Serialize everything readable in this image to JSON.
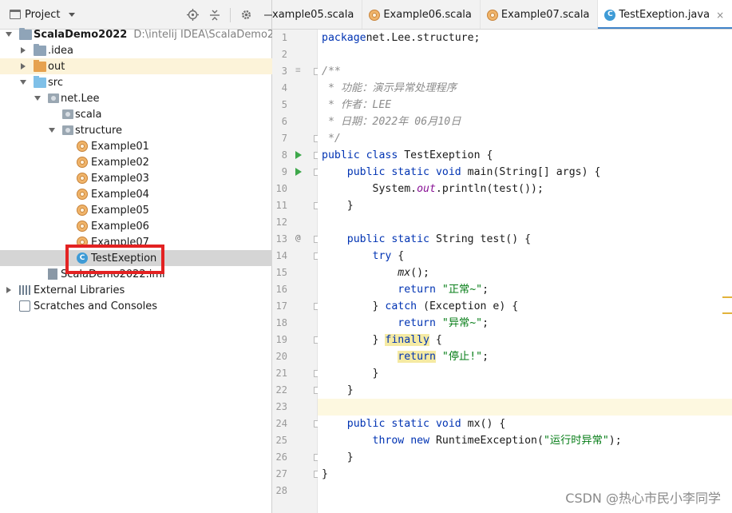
{
  "project_panel": {
    "title": "Project",
    "tree": [
      {
        "label": "ScalaDemo2022",
        "extra": "D:\\intelij IDEA\\ScalaDemo2022",
        "icon": "module-folder-icon",
        "indent": 0,
        "arrow": "down",
        "bold": true
      },
      {
        "label": ".idea",
        "icon": "folder-icon",
        "indent": 1,
        "arrow": "right"
      },
      {
        "label": "out",
        "icon": "excluded-folder-icon",
        "indent": 1,
        "arrow": "right",
        "highlight": "out"
      },
      {
        "label": "src",
        "icon": "source-folder-icon",
        "indent": 1,
        "arrow": "down"
      },
      {
        "label": "net.Lee",
        "icon": "package-icon",
        "indent": 2,
        "arrow": "down"
      },
      {
        "label": "scala",
        "icon": "package-icon",
        "indent": 3,
        "arrow": "none"
      },
      {
        "label": "structure",
        "icon": "package-icon",
        "indent": 3,
        "arrow": "down"
      },
      {
        "label": "Example01",
        "icon": "scala-object-icon",
        "indent": 4,
        "arrow": "none"
      },
      {
        "label": "Example02",
        "icon": "scala-object-icon",
        "indent": 4,
        "arrow": "none"
      },
      {
        "label": "Example03",
        "icon": "scala-object-icon",
        "indent": 4,
        "arrow": "none"
      },
      {
        "label": "Example04",
        "icon": "scala-object-icon",
        "indent": 4,
        "arrow": "none"
      },
      {
        "label": "Example05",
        "icon": "scala-object-icon",
        "indent": 4,
        "arrow": "none"
      },
      {
        "label": "Example06",
        "icon": "scala-object-icon",
        "indent": 4,
        "arrow": "none"
      },
      {
        "label": "Example07",
        "icon": "scala-object-icon",
        "indent": 4,
        "arrow": "none"
      },
      {
        "label": "TestExeption",
        "icon": "java-class-icon",
        "indent": 4,
        "arrow": "none",
        "selected": true
      },
      {
        "label": "ScalaDemo2022.iml",
        "icon": "iml-file-icon",
        "indent": 2,
        "arrow": "none"
      },
      {
        "label": "External Libraries",
        "icon": "libraries-icon",
        "indent": 0,
        "arrow": "right"
      },
      {
        "label": "Scratches and Consoles",
        "icon": "scratches-icon",
        "indent": 0,
        "arrow": "none"
      }
    ]
  },
  "editor": {
    "tabs": [
      {
        "label": "xample05.scala",
        "icon": "scala-object-icon",
        "active": false,
        "has_icon": false
      },
      {
        "label": "Example06.scala",
        "icon": "scala-object-icon",
        "active": false
      },
      {
        "label": "Example07.scala",
        "icon": "scala-object-icon",
        "active": false
      },
      {
        "label": "TestExeption.java",
        "icon": "java-class-icon",
        "active": true,
        "close": "×"
      }
    ],
    "current_line": 23,
    "lines": [
      {
        "n": "1",
        "tokens": [
          [
            "kw",
            "package"
          ],
          [
            "",
            "net.Lee.structure;"
          ]
        ]
      },
      {
        "n": "2",
        "tokens": []
      },
      {
        "n": "3",
        "tokens": [
          [
            "doc",
            "/**"
          ]
        ],
        "gutter": "doc"
      },
      {
        "n": "4",
        "tokens": [
          [
            "doc",
            " * 功能：演示异常处理程序"
          ]
        ]
      },
      {
        "n": "5",
        "tokens": [
          [
            "doc",
            " * 作者：LEE"
          ]
        ]
      },
      {
        "n": "6",
        "tokens": [
          [
            "doc",
            " * 日期：2022年 06月10日"
          ]
        ]
      },
      {
        "n": "7",
        "tokens": [
          [
            "doc",
            " */"
          ]
        ]
      },
      {
        "n": "8",
        "tokens": [
          [
            "kw",
            "public"
          ],
          [
            "",
            " "
          ],
          [
            "kw",
            "class"
          ],
          [
            "",
            " TestExeption {"
          ]
        ],
        "gutter": "run"
      },
      {
        "n": "9",
        "tokens": [
          [
            "",
            "    "
          ],
          [
            "kw",
            "public"
          ],
          [
            "",
            " "
          ],
          [
            "kw",
            "static"
          ],
          [
            "",
            " "
          ],
          [
            "kw",
            "void"
          ],
          [
            "",
            " main(String[] args) {"
          ]
        ],
        "gutter": "run"
      },
      {
        "n": "10",
        "tokens": [
          [
            "",
            "        System."
          ],
          [
            "fn-italic",
            "out"
          ],
          [
            "",
            ".println(test());"
          ]
        ]
      },
      {
        "n": "11",
        "tokens": [
          [
            "",
            "    }"
          ]
        ]
      },
      {
        "n": "12",
        "tokens": []
      },
      {
        "n": "13",
        "tokens": [
          [
            "",
            "    "
          ],
          [
            "kw",
            "public"
          ],
          [
            "",
            " "
          ],
          [
            "kw",
            "static"
          ],
          [
            "",
            " String test() {"
          ]
        ],
        "gutter": "at"
      },
      {
        "n": "14",
        "tokens": [
          [
            "",
            "        "
          ],
          [
            "kw",
            "try"
          ],
          [
            "",
            " {"
          ]
        ]
      },
      {
        "n": "15",
        "tokens": [
          [
            "",
            "            "
          ],
          [
            "italic",
            "mx"
          ],
          [
            "",
            "();"
          ]
        ]
      },
      {
        "n": "16",
        "tokens": [
          [
            "",
            "            "
          ],
          [
            "kw",
            "return"
          ],
          [
            "",
            " "
          ],
          [
            "str",
            "\"正常~\""
          ],
          [
            "",
            ";"
          ]
        ]
      },
      {
        "n": "17",
        "tokens": [
          [
            "",
            "        } "
          ],
          [
            "kw",
            "catch"
          ],
          [
            "",
            " (Exception e) {"
          ]
        ]
      },
      {
        "n": "18",
        "tokens": [
          [
            "",
            "            "
          ],
          [
            "kw",
            "return"
          ],
          [
            "",
            " "
          ],
          [
            "str",
            "\"异常~\""
          ],
          [
            "",
            ";"
          ]
        ]
      },
      {
        "n": "19",
        "tokens": [
          [
            "",
            "        } "
          ],
          [
            "kw hl",
            "finally"
          ],
          [
            "",
            " {"
          ]
        ]
      },
      {
        "n": "20",
        "tokens": [
          [
            "",
            "            "
          ],
          [
            "kw hl",
            "return"
          ],
          [
            "",
            " "
          ],
          [
            "str",
            "\"停止!\""
          ],
          [
            "",
            ";"
          ]
        ]
      },
      {
        "n": "21",
        "tokens": [
          [
            "",
            "        }"
          ]
        ]
      },
      {
        "n": "22",
        "tokens": [
          [
            "",
            "    }"
          ]
        ]
      },
      {
        "n": "23",
        "tokens": []
      },
      {
        "n": "24",
        "tokens": [
          [
            "",
            "    "
          ],
          [
            "kw",
            "public"
          ],
          [
            "",
            " "
          ],
          [
            "kw",
            "static"
          ],
          [
            "",
            " "
          ],
          [
            "kw",
            "void"
          ],
          [
            "",
            " mx() {"
          ]
        ]
      },
      {
        "n": "25",
        "tokens": [
          [
            "",
            "        "
          ],
          [
            "kw",
            "throw"
          ],
          [
            "",
            " "
          ],
          [
            "kw",
            "new"
          ],
          [
            "",
            " RuntimeException("
          ],
          [
            "str",
            "\"运行时异常\""
          ],
          [
            "",
            ");"
          ]
        ]
      },
      {
        "n": "26",
        "tokens": [
          [
            "",
            "    }"
          ]
        ]
      },
      {
        "n": "27",
        "tokens": [
          [
            "",
            "}"
          ]
        ]
      },
      {
        "n": "28",
        "tokens": []
      }
    ]
  },
  "watermark": "CSDN @热心市民小李同学",
  "colors": {
    "keyword": "#0033b3",
    "string": "#067d17",
    "doc_comment": "#8c8c8c",
    "static_field": "#871094",
    "active_tab_underline": "#4083c9",
    "selection_box": "#e32222"
  }
}
